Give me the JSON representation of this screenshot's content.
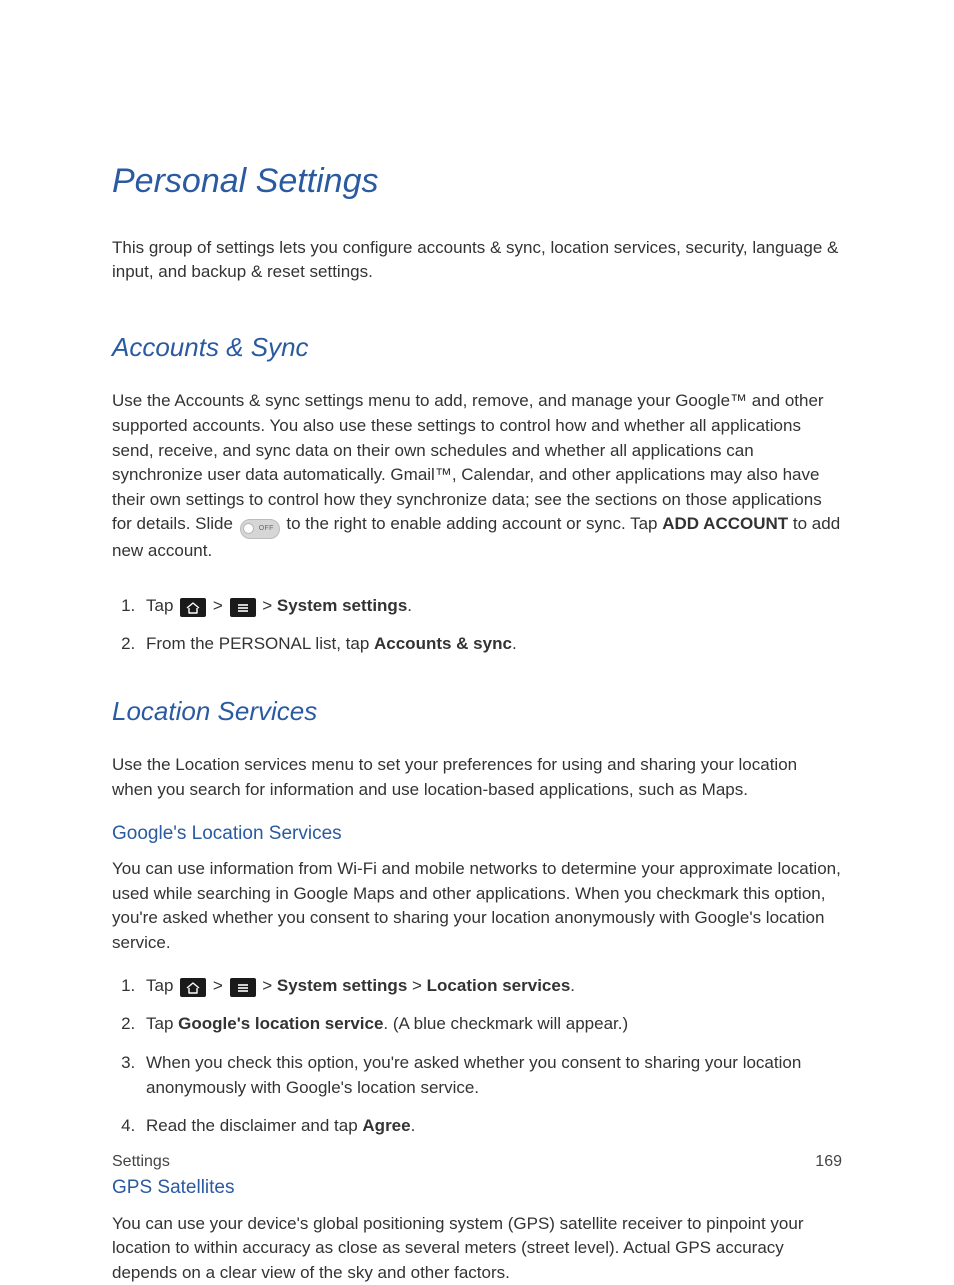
{
  "title": "Personal Settings",
  "intro": "This group of settings lets you configure accounts & sync, location services, security, language & input, and backup & reset settings.",
  "accounts": {
    "heading": "Accounts & Sync",
    "para_a": "Use the Accounts & sync settings menu to add, remove, and manage your Google™ and other supported accounts. You also use these settings to control how and whether all applications send, receive, and sync data on their own schedules and whether all applications can synchronize user data automatically. Gmail™, Calendar, and other applications may also have their own settings to control how they synchronize data; see the sections on those applications for details. Slide ",
    "para_b": " to the right to enable adding account or sync. Tap ",
    "add_account": "ADD ACCOUNT",
    "para_c": " to add new account.",
    "steps": {
      "s1_tap": "Tap ",
      "gt": " > ",
      "system_settings": "System settings",
      "s1_end": ".",
      "s2_a": "From the PERSONAL list, tap ",
      "s2_b": "Accounts & sync",
      "s2_c": "."
    }
  },
  "location": {
    "heading": "Location Services",
    "para": "Use the Location services menu to set your preferences for using and sharing your location when you search for information and use location-based applications, such as Maps.",
    "google": {
      "heading": "Google's Location Services",
      "para": "You can use information from Wi-Fi and mobile networks to determine your approximate location, used while searching in Google Maps and other applications. When you checkmark this option, you're asked whether you consent to sharing your location anonymously with Google's location service.",
      "steps": {
        "s1_tap": "Tap ",
        "gt": " > ",
        "system_settings": "System settings",
        "location_services": "Location services",
        "s1_end": ".",
        "s2_a": "Tap ",
        "s2_b": "Google's location service",
        "s2_c": ". (A blue checkmark will appear.)",
        "s3": "When you check this option, you're asked whether you consent to sharing your location anonymously with Google's location service.",
        "s4_a": "Read the disclaimer and tap ",
        "s4_b": "Agree",
        "s4_c": "."
      }
    },
    "gps": {
      "heading": "GPS Satellites",
      "para": "You can use your device's global positioning system (GPS) satellite receiver to pinpoint your location to within accuracy as close as several meters (street level). Actual GPS accuracy depends on a clear view of the sky and other factors."
    }
  },
  "toggle_label": "OFF",
  "footer": {
    "section": "Settings",
    "page": "169"
  }
}
